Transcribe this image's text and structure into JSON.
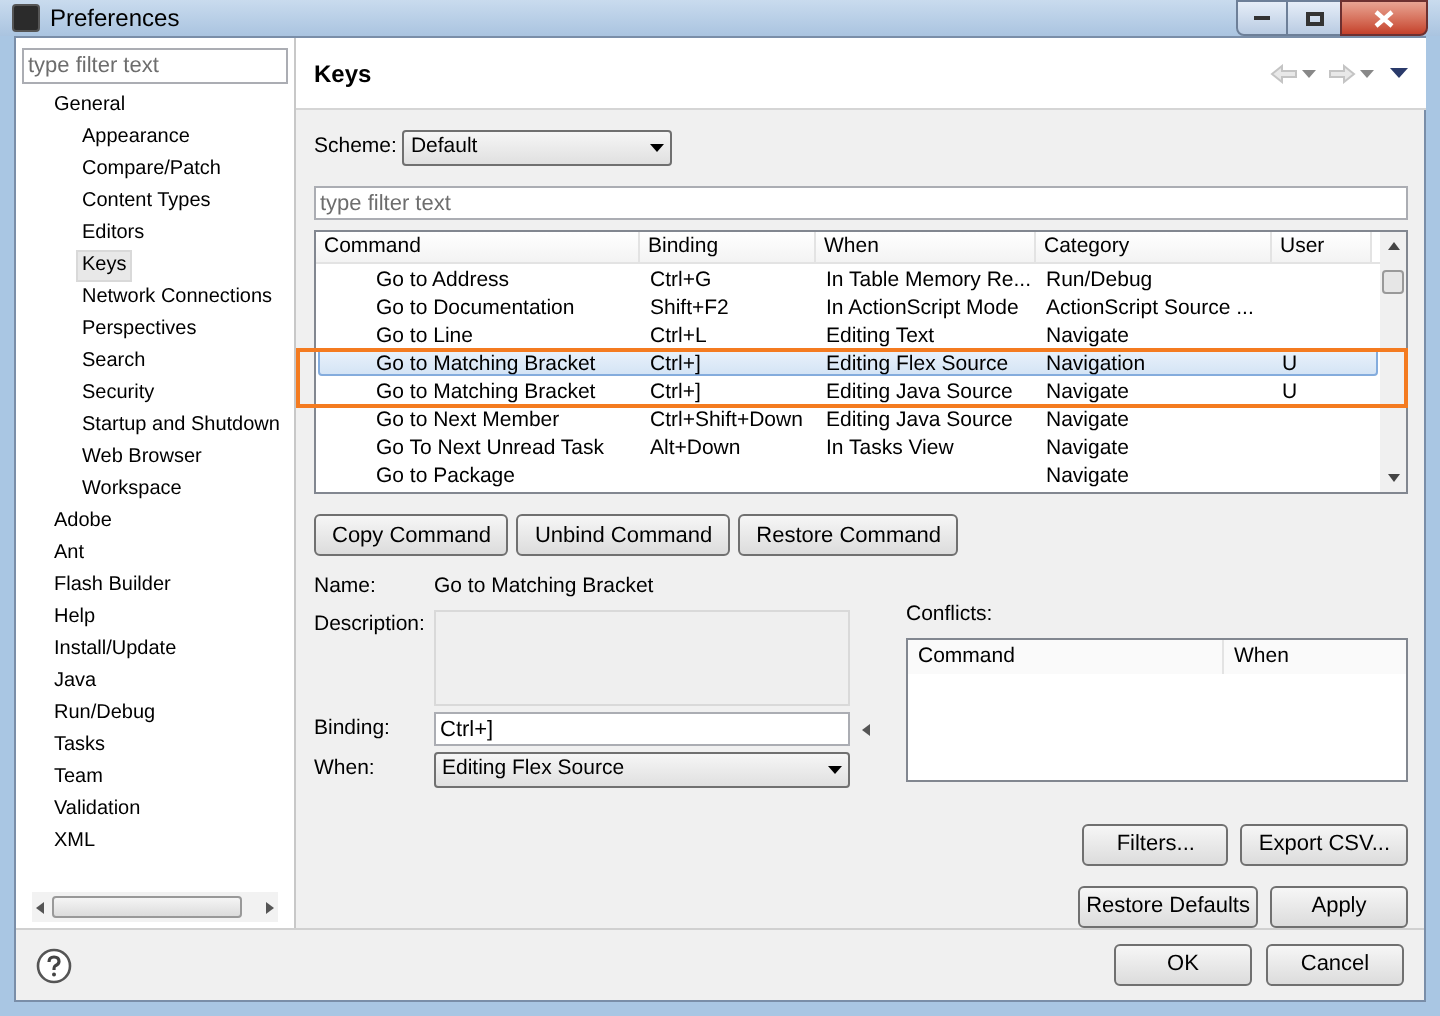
{
  "window": {
    "title": "Preferences"
  },
  "sidebar": {
    "filter_placeholder": "type filter text",
    "items": [
      {
        "label": "General",
        "selected": false,
        "children": [
          {
            "label": "Appearance",
            "selected": false
          },
          {
            "label": "Compare/Patch",
            "selected": false
          },
          {
            "label": "Content Types",
            "selected": false
          },
          {
            "label": "Editors",
            "selected": false
          },
          {
            "label": "Keys",
            "selected": true
          },
          {
            "label": "Network Connections",
            "selected": false
          },
          {
            "label": "Perspectives",
            "selected": false
          },
          {
            "label": "Search",
            "selected": false
          },
          {
            "label": "Security",
            "selected": false
          },
          {
            "label": "Startup and Shutdown",
            "selected": false
          },
          {
            "label": "Web Browser",
            "selected": false
          },
          {
            "label": "Workspace",
            "selected": false
          }
        ]
      },
      {
        "label": "Adobe",
        "selected": false
      },
      {
        "label": "Ant",
        "selected": false
      },
      {
        "label": "Flash Builder",
        "selected": false
      },
      {
        "label": "Help",
        "selected": false
      },
      {
        "label": "Install/Update",
        "selected": false
      },
      {
        "label": "Java",
        "selected": false
      },
      {
        "label": "Run/Debug",
        "selected": false
      },
      {
        "label": "Tasks",
        "selected": false
      },
      {
        "label": "Team",
        "selected": false
      },
      {
        "label": "Validation",
        "selected": false
      },
      {
        "label": "XML",
        "selected": false
      }
    ]
  },
  "page": {
    "title": "Keys",
    "scheme": {
      "label": "Scheme:",
      "value": "Default"
    },
    "filter_placeholder": "type filter text",
    "table": {
      "columns": [
        "Command",
        "Binding",
        "When",
        "Category",
        "User"
      ],
      "rows": [
        {
          "command": "Go to Address",
          "binding": "Ctrl+G",
          "when": "In Table Memory Re...",
          "category": "Run/Debug",
          "selected": false
        },
        {
          "command": "Go to Documentation",
          "binding": "Shift+F2",
          "when": "In ActionScript Mode",
          "category": "ActionScript Source ...",
          "selected": false
        },
        {
          "command": "Go to Line",
          "binding": "Ctrl+L",
          "when": "Editing Text",
          "category": "Navigate",
          "selected": false
        },
        {
          "command": "Go to Matching Bracket",
          "binding": "Ctrl+]",
          "when": "Editing Flex Source",
          "category": "Navigation",
          "user": "U",
          "selected": true
        },
        {
          "command": "Go to Matching Bracket",
          "binding": "Ctrl+]",
          "when": "Editing Java Source",
          "category": "Navigate",
          "user": "U",
          "selected": false
        },
        {
          "command": "Go to Next Member",
          "binding": "Ctrl+Shift+Down",
          "when": "Editing Java Source",
          "category": "Navigate",
          "selected": false
        },
        {
          "command": "Go To Next Unread Task",
          "binding": "Alt+Down",
          "when": "In Tasks View",
          "category": "Navigate",
          "selected": false
        },
        {
          "command": "Go to Package",
          "category": "Navigate",
          "selected": false
        }
      ]
    },
    "command_buttons": [
      "Copy Command",
      "Unbind Command",
      "Restore Command"
    ],
    "details": {
      "name_label": "Name:",
      "name_value": "Go to Matching Bracket",
      "description_label": "Description:",
      "binding_label": "Binding:",
      "binding_value": "Ctrl+]",
      "when_label": "When:",
      "when_value": "Editing Flex Source"
    },
    "conflicts": {
      "label": "Conflicts:",
      "columns": [
        "Command",
        "When"
      ]
    },
    "tool_buttons": [
      "Filters...",
      "Export CSV..."
    ],
    "page_buttons": [
      "Restore Defaults",
      "Apply"
    ]
  },
  "footer_buttons": [
    "OK",
    "Cancel"
  ]
}
